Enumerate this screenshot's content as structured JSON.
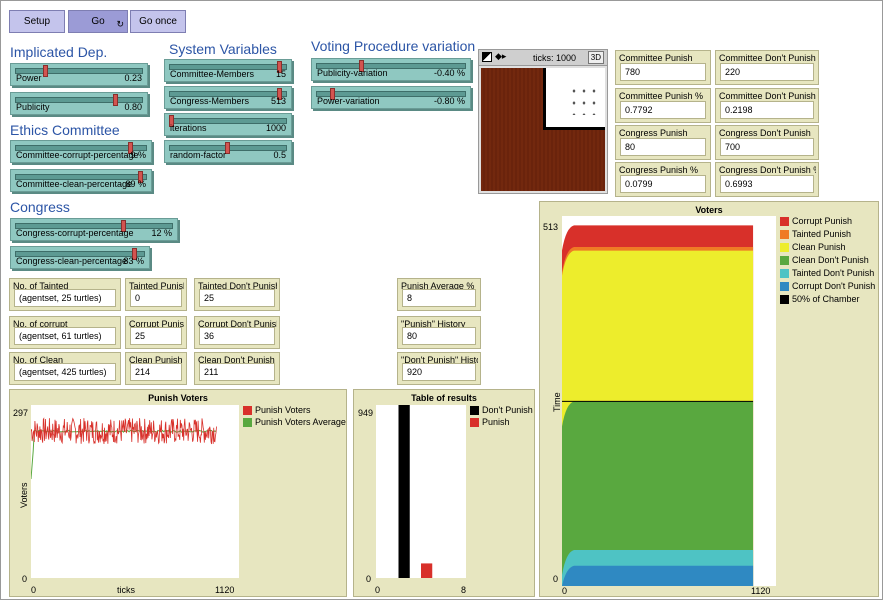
{
  "colors": {
    "button": "#c4c4ec",
    "slider": "#8fc8c1",
    "monitor": "#e7e6c0",
    "label": "#2c55a6",
    "knob": "#d35450"
  },
  "buttons": {
    "setup": "Setup",
    "go": "Go",
    "go_once": "Go once",
    "go_icon": "loop-icon"
  },
  "headings": {
    "implicated": "Implicated Dep.",
    "system": "System Variables",
    "voting": "Voting Procedure variation",
    "ethics": "Ethics Committee",
    "congress": "Congress"
  },
  "sliders": [
    {
      "name": "Power",
      "value": "0.23",
      "level": 0.23
    },
    {
      "name": "Publicity",
      "value": "0.80",
      "level": 0.8
    },
    {
      "name": "Committee-Members",
      "value": "15",
      "level": 0.96
    },
    {
      "name": "Congress-Members",
      "value": "513",
      "level": 0.96
    },
    {
      "name": "iterations",
      "value": "1000",
      "level": 0.0
    },
    {
      "name": "random-factor",
      "value": "0.5",
      "level": 0.5
    },
    {
      "name": "Publicity-variation",
      "value": "-0.40 %",
      "level": 0.3
    },
    {
      "name": "Power-variation",
      "value": "-0.80 %",
      "level": 0.1
    },
    {
      "name": "Committee-corrupt-percentage",
      "value": "9 %",
      "level": 0.9
    },
    {
      "name": "Committee-clean-percentage",
      "value": "89 %",
      "level": 0.98
    },
    {
      "name": "Congress-corrupt-percentage",
      "value": "12 %",
      "level": 0.7
    },
    {
      "name": "Congress-clean-percentage",
      "value": "83 %",
      "level": 0.94
    }
  ],
  "view": {
    "ticks": "ticks: 1000",
    "three_d": "3D"
  },
  "monitors_right": [
    {
      "title": "Committee Punish",
      "value": "780"
    },
    {
      "title": "Committee Don't Punish",
      "value": "220"
    },
    {
      "title": "Committee Punish %",
      "value": "0.7792"
    },
    {
      "title": "Committee Don't Punish %",
      "value": "0.2198"
    },
    {
      "title": "Congress Punish",
      "value": "80"
    },
    {
      "title": "Congress Don't Punish",
      "value": "700"
    },
    {
      "title": "Congress Punish %",
      "value": "0.0799"
    },
    {
      "title": "Congress Don't Punish %",
      "value": "0.6993"
    }
  ],
  "monitors_left": [
    {
      "title": "No. of Tainted",
      "value": "(agentset, 25 turtles)"
    },
    {
      "title": "Tainted Punish",
      "value": "0"
    },
    {
      "title": "Tainted Don't Punish",
      "value": "25"
    },
    {
      "title": "No. of corrupt",
      "value": "(agentset, 61 turtles)"
    },
    {
      "title": "Corrupt Punish",
      "value": "25"
    },
    {
      "title": "Corrupt Don't Punish",
      "value": "36"
    },
    {
      "title": "No. of Clean",
      "value": "(agentset, 425 turtles)"
    },
    {
      "title": "Clean Punish",
      "value": "214"
    },
    {
      "title": "Clean Don't Punish",
      "value": "211"
    }
  ],
  "monitors_mid": [
    {
      "title": "Punish Average %",
      "value": "8"
    },
    {
      "title": "\"Punish\" History",
      "value": "80"
    },
    {
      "title": "\"Don't Punish\" History",
      "value": "920"
    }
  ],
  "chart_data": [
    {
      "type": "line",
      "title": "Punish Voters",
      "xlabel": "ticks",
      "ylabel": "Voters",
      "xlim": [
        0,
        1120
      ],
      "ylim": [
        0,
        297
      ],
      "x_ticks": [
        "0",
        "1120"
      ],
      "y_ticks": [
        "0",
        "297"
      ],
      "legend_position": "right",
      "series": [
        {
          "name": "Punish Voters",
          "color": "#d8302a",
          "x_range": [
            0,
            1000
          ],
          "y_range": [
            230,
            275
          ]
        },
        {
          "name": "Punish Voters Average",
          "color": "#59a83f",
          "x_range": [
            0,
            1000
          ],
          "y_range": [
            170,
            255
          ]
        }
      ]
    },
    {
      "type": "bar",
      "title": "Table of results",
      "xlim": [
        0,
        8
      ],
      "ylim": [
        0,
        949
      ],
      "x_ticks": [
        "0",
        "8"
      ],
      "y_ticks": [
        "0",
        "949"
      ],
      "legend_position": "right",
      "series": [
        {
          "name": "Don't Punish",
          "color": "#000000",
          "x": 2,
          "value": 949
        },
        {
          "name": "Punish",
          "color": "#d8302a",
          "x": 4,
          "value": 80
        }
      ]
    },
    {
      "type": "area",
      "title": "Voters",
      "ylabel": "Time",
      "xlim": [
        0,
        1120
      ],
      "ylim": [
        0,
        513
      ],
      "x_ticks": [
        "0",
        "1120"
      ],
      "y_ticks": [
        "0",
        "513"
      ],
      "legend_position": "right",
      "series": [
        {
          "name": "Corrupt Punish",
          "color": "#d8302a",
          "top": 500
        },
        {
          "name": "Tainted Punish",
          "color": "#ef7a25",
          "top": 470
        },
        {
          "name": "Clean Punish",
          "color": "#eded2c",
          "top": 465
        },
        {
          "name": "Clean Don't Punish",
          "color": "#59a83f",
          "top": 256
        },
        {
          "name": "Tainted Don't Punish",
          "color": "#4ec3c4",
          "top": 50
        },
        {
          "name": "Corrupt Don't Punish",
          "color": "#2f89c2",
          "top": 28
        },
        {
          "name": "50% of Chamber",
          "color": "#000000",
          "value": 256
        }
      ]
    }
  ]
}
